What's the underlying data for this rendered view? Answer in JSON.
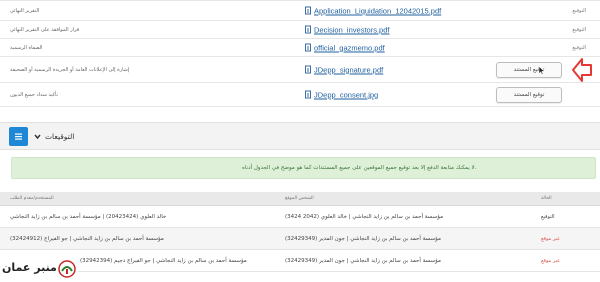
{
  "documents": [
    {
      "label": "التوقيع",
      "file": "Application_Liquidation_12042015.pdf",
      "desc": "التقرير النهائي"
    },
    {
      "label": "التوقيع",
      "file": "Decision_investors.pdf",
      "desc": "قرار الموافقة على التقرير النهائي"
    },
    {
      "label": "التوقيع",
      "file": "official_gazmemo.pdf",
      "desc": "الصفاة الرسمية"
    },
    {
      "label": "",
      "file": "JDepp_signature.pdf",
      "desc": "إشارة إلى الإعلانات العامة أو الجريدة الرسمية أو الصحيفة",
      "button": "توقيع المستند"
    },
    {
      "label": "",
      "file": "JDepp_consent.jpg",
      "desc": "تأكيد سداد جميع الديون",
      "button": "توقيع المستند"
    }
  ],
  "signatures_section": {
    "title": "التوقيعات",
    "alert": "لا يمكنك متابعة الدفع إلا بعد توقيع جميع الموقعين على جميع المستندات كما هو موضح في الجدول أدناه."
  },
  "signatures_table": {
    "headers": {
      "requester": "المستخدم/مقدم الطلب",
      "signatory": "الشخص الموقع",
      "state": "الحالة"
    },
    "rows": [
      {
        "requester": "خالد العلوي (20423424) | مؤسسة أحمد بن سالم بن زايد النجاشي",
        "signatory": "مؤسسة أحمد بن سالم بن زايد النجاشي | خالد العلوي (2042 3424)",
        "state": "التوقيع",
        "status": "signed"
      },
      {
        "requester": "مؤسسة أحمد بن سالم بن زايد النجاشي | جو الفيراج (32424912)",
        "signatory": "مؤسسة أحمد بن سالم بن زايد النجاشي | جون المدير (32429349)",
        "state": "غير موقع",
        "status": "unsigned"
      },
      {
        "requester": "مؤسسة أحمد بن سالم بن زايد النجاشي | جو الفيراج دجيم (32942394)",
        "signatory": "مؤسسة أحمد بن سالم بن زايد النجاشي | جون المدير (32429349)",
        "state": "غير موقع",
        "status": "unsigned"
      }
    ]
  },
  "logo": {
    "text": "منبر عمان"
  },
  "colors": {
    "link": "#1f5f9f",
    "accent": "#1e88d6",
    "arrow": "#e53935",
    "alert_bg": "#dff0d8",
    "alert_text": "#3c763d",
    "unsigned": "#d9534f"
  }
}
